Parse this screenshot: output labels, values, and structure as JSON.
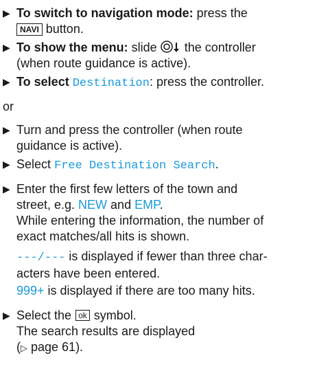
{
  "arrow_icon": "▶",
  "step1": {
    "bold": "To switch to navigation mode:",
    "pre": " press the ",
    "key": "NAVI",
    "post": " button."
  },
  "step2": {
    "bold": "To show the menu:",
    "pre": " slide ",
    "post": " the controller",
    "line2": "(when route guidance is active)."
  },
  "step3": {
    "bold": "To select",
    "term": "Destination",
    "post": ": press the controller."
  },
  "or": "or",
  "step4": {
    "line1": "Turn and press the controller (when route",
    "line2": "guidance is active)."
  },
  "step5": {
    "pre": "Select ",
    "term": "Free Destination Search",
    "post": "."
  },
  "step6": {
    "line1": "Enter the first few letters of the town and",
    "l2_pre": "street, e.g. ",
    "term1": "NEW",
    "and": " and ",
    "term2": "EMP",
    "l2_post": ".",
    "line3": "While entering the information, the number of",
    "line4": "exact matches/all hits is shown."
  },
  "note1": {
    "code": "---/---",
    "line1_post": " is displayed if fewer than three char-",
    "line2": "acters have been entered."
  },
  "note2": {
    "code": "999+",
    "post": " is displayed if there are too many hits."
  },
  "step7": {
    "pre": "Select the",
    "key": "ok",
    "post": "symbol.",
    "line2": "The search results are displayed",
    "ref_icon": "▷",
    "ref_text": " page 61).",
    "ref_open": "("
  }
}
